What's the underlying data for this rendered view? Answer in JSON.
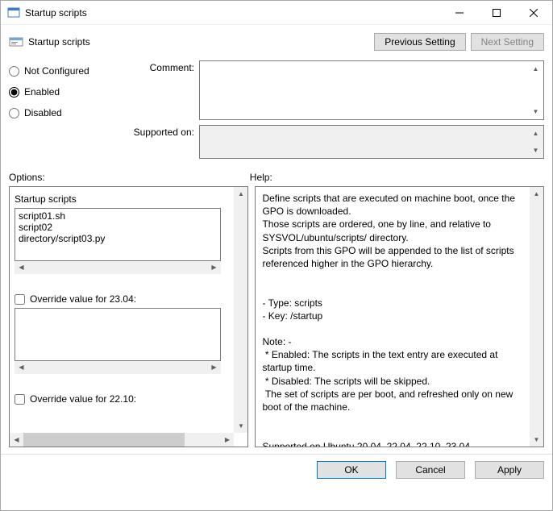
{
  "window": {
    "title": "Startup scripts"
  },
  "subheader": {
    "title": "Startup scripts",
    "prev_button": "Previous Setting",
    "next_button": "Next Setting",
    "next_disabled": true
  },
  "state": {
    "not_configured": "Not Configured",
    "enabled": "Enabled",
    "disabled": "Disabled",
    "selected": "enabled"
  },
  "comment": {
    "label": "Comment:",
    "value": ""
  },
  "supported": {
    "label": "Supported on:",
    "value": ""
  },
  "options_label": "Options:",
  "help_label": "Help:",
  "options": {
    "block1": {
      "title": "Startup scripts",
      "items": [
        "script01.sh",
        "script02",
        "directory/script03.py"
      ]
    },
    "override1": {
      "label": "Override value for 23.04:",
      "checked": false,
      "value": ""
    },
    "override2": {
      "label": "Override value for 22.10:",
      "checked": false
    }
  },
  "help": {
    "text": "Define scripts that are executed on machine boot, once the GPO is downloaded.\nThose scripts are ordered, one by line, and relative to SYSVOL/ubuntu/scripts/ directory.\nScripts from this GPO will be appended to the list of scripts referenced higher in the GPO hierarchy.\n\n\n- Type: scripts\n- Key: /startup\n\nNote: -\n * Enabled: The scripts in the text entry are executed at startup time.\n * Disabled: The scripts will be skipped.\n The set of scripts are per boot, and refreshed only on new boot of the machine.\n\n\nSupported on Ubuntu 20.04, 22.04, 22.10, 23.04."
  },
  "footer": {
    "ok": "OK",
    "cancel": "Cancel",
    "apply": "Apply"
  }
}
